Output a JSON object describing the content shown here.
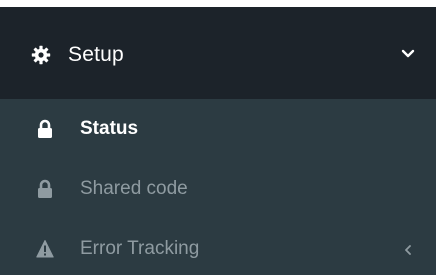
{
  "colors": {
    "header_bg": "#1c232a",
    "list_bg": "#2c3b42",
    "active_text": "#ffffff",
    "inactive_text": "#8f9ba1"
  },
  "menu": {
    "header": {
      "icon": "gear-icon",
      "label": "Setup",
      "toggle_icon": "chevron-down-icon"
    },
    "items": [
      {
        "icon": "lock-icon",
        "label": "Status",
        "active": true
      },
      {
        "icon": "lock-icon",
        "label": "Shared code",
        "active": false
      },
      {
        "icon": "warning-icon",
        "label": "Error Tracking",
        "active": false,
        "trailing_icon": "angle-left-icon"
      }
    ]
  }
}
